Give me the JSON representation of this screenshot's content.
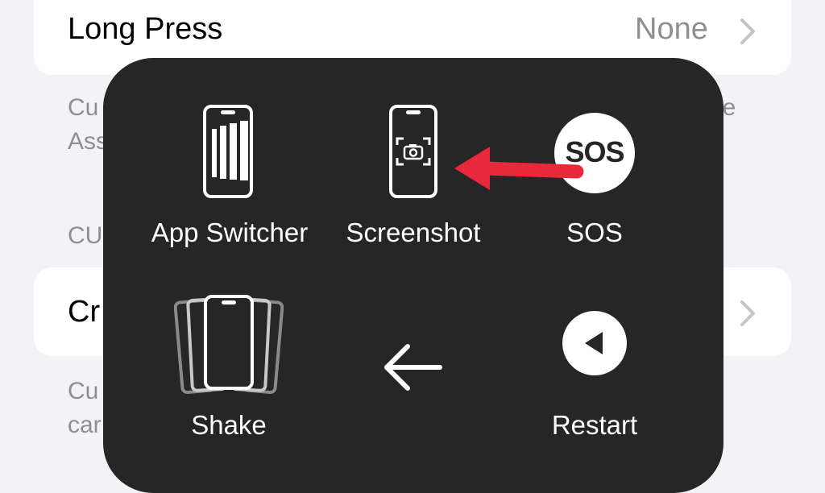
{
  "settings": {
    "long_press": {
      "label": "Long Press",
      "value": "None"
    },
    "footnote_1": {
      "line1": "Cu",
      "line2": "Ass",
      "right_fragment": "ne"
    },
    "section_header": "CU",
    "row_2": {
      "label": "Cr"
    },
    "footnote_2": {
      "line1": "Cu",
      "line2": "car"
    }
  },
  "menu": {
    "items": [
      {
        "label": "App Switcher",
        "icon": "app-switcher-icon"
      },
      {
        "label": "Screenshot",
        "icon": "screenshot-icon"
      },
      {
        "label": "SOS",
        "icon": "sos-icon",
        "badge": "SOS"
      },
      {
        "label": "Shake",
        "icon": "shake-icon"
      },
      {
        "label": "",
        "icon": "back-arrow-icon"
      },
      {
        "label": "Restart",
        "icon": "restart-icon"
      }
    ]
  },
  "annotation": {
    "icon": "red-pointer-arrow",
    "color": "#e8293b"
  },
  "colors": {
    "menu_bg": "#262626",
    "page_bg": "#f2f2f7",
    "accent_red": "#e8293b"
  }
}
